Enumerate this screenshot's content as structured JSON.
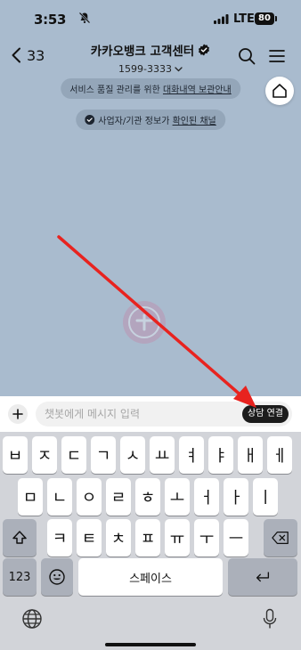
{
  "status_bar": {
    "time": "3:53",
    "network": "LTE",
    "battery": "80"
  },
  "header": {
    "back_count": "33",
    "title": "카카오뱅크 고객센터",
    "phone": "1599-3333"
  },
  "chat": {
    "notice1_prefix": "서비스 품질 관리를 위한 ",
    "notice1_link": "대화내역 보관안내",
    "notice2_prefix": "사업자/기관 정보가 ",
    "notice2_link": "확인된 채널"
  },
  "input": {
    "placeholder": "챗봇에게 메시지 입력",
    "connect_label": "상담 연결"
  },
  "keyboard": {
    "row1": [
      "ㅂ",
      "ㅈ",
      "ㄷ",
      "ㄱ",
      "ㅅ",
      "ㅛ",
      "ㅕ",
      "ㅑ",
      "ㅐ",
      "ㅔ"
    ],
    "row2": [
      "ㅁ",
      "ㄴ",
      "ㅇ",
      "ㄹ",
      "ㅎ",
      "ㅗ",
      "ㅓ",
      "ㅏ",
      "ㅣ"
    ],
    "row3": [
      "ㅋ",
      "ㅌ",
      "ㅊ",
      "ㅍ",
      "ㅠ",
      "ㅜ",
      "ㅡ"
    ],
    "numbers_label": "123",
    "space_label": "스페이스"
  },
  "icons": {
    "back": "chevron-left-icon",
    "verified": "verified-badge-icon",
    "search": "search-icon",
    "menu": "hamburger-menu-icon",
    "home": "home-icon",
    "plus": "plus-icon",
    "shift": "shift-icon",
    "delete": "backspace-icon",
    "emoji": "emoji-icon",
    "return": "return-icon",
    "globe": "globe-icon",
    "mic": "microphone-icon"
  },
  "colors": {
    "chat_background": "#a9bbce",
    "annotation_arrow": "#e8231f",
    "connect_button": "#1c1c1c",
    "keyboard_background": "#d2d4d9"
  }
}
